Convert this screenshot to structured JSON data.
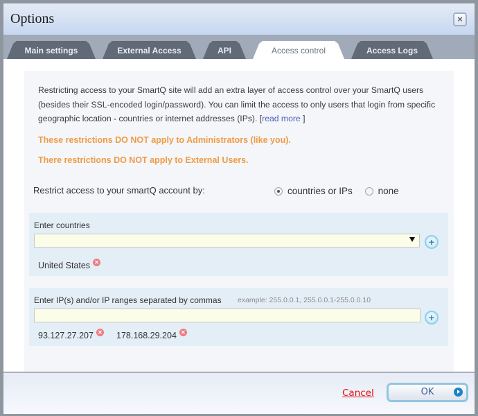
{
  "dialog": {
    "title": "Options",
    "close_icon": "close-icon"
  },
  "tabs": [
    {
      "label": "Main settings",
      "active": false
    },
    {
      "label": "External Access",
      "active": false
    },
    {
      "label": "API",
      "active": false
    },
    {
      "label": "Access control",
      "active": true
    },
    {
      "label": "Access Logs",
      "active": false
    }
  ],
  "intro": {
    "text": "Restricting access to your SmartQ site will add an extra layer of access control over your SmartQ users (besides their SSL-encoded login/password). You can limit the access to only users that login from specific geographic location - countries or internet addresses (IPs).",
    "link_open": "[",
    "link_label": "read more",
    "link_close": "]"
  },
  "warnings": [
    "These restrictions DO NOT apply to Administrators (like you).",
    "There restrictions DO NOT apply to External Users."
  ],
  "restrict": {
    "label": "Restrict access to your smartQ account by:",
    "options": [
      {
        "label": "countries or IPs",
        "selected": true
      },
      {
        "label": "none",
        "selected": false
      }
    ]
  },
  "countries": {
    "label": "Enter countries",
    "selected_value": "",
    "items": [
      "United States"
    ]
  },
  "ips": {
    "label": "Enter IP(s) and/or IP ranges separated by commas",
    "example": "example: 255.0.0.1, 255.0.0.1-255.0.0.10",
    "value": "",
    "items": [
      "93.127.27.207",
      "178.168.29.204"
    ]
  },
  "footer": {
    "cancel_label": "Cancel",
    "ok_label": "OK"
  },
  "colors": {
    "warning": "#f09a45",
    "link": "#4c5fb8",
    "cancel": "#e01010",
    "tab_inactive": "#626a78"
  }
}
